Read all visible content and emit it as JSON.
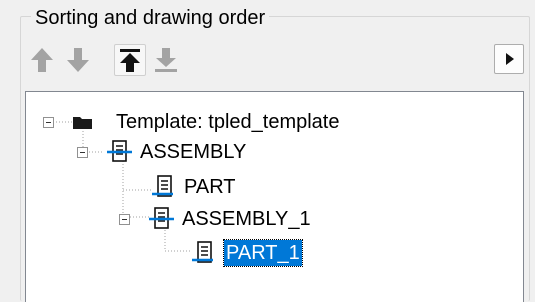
{
  "group": {
    "title": "Sorting and drawing order"
  },
  "toolbar": {
    "buttons": [
      {
        "name": "move-up",
        "icon": "arrow-up-icon",
        "enabled": false
      },
      {
        "name": "move-down",
        "icon": "arrow-down-icon",
        "enabled": false
      },
      {
        "name": "move-to-top",
        "icon": "arrow-to-top-icon",
        "enabled": true
      },
      {
        "name": "move-to-bottom",
        "icon": "arrow-to-bottom-icon",
        "enabled": false
      }
    ],
    "expand_icon": "play-triangle-icon"
  },
  "tree": {
    "nodes": [
      {
        "label": "Template: tpled_template",
        "icon": "folder-icon",
        "level": 0,
        "expanded": true,
        "selected": false
      },
      {
        "label": "ASSEMBLY",
        "icon": "assembly-document-icon",
        "level": 1,
        "expanded": true,
        "selected": false
      },
      {
        "label": "PART",
        "icon": "part-document-icon",
        "level": 2,
        "expanded": false,
        "selected": false
      },
      {
        "label": "ASSEMBLY_1",
        "icon": "assembly-document-icon",
        "level": 2,
        "expanded": true,
        "selected": false
      },
      {
        "label": "PART_1",
        "icon": "part-document-icon",
        "level": 3,
        "expanded": false,
        "selected": true
      }
    ]
  },
  "colors": {
    "selection": "#0078d7",
    "icon_accent": "#0078d7",
    "disabled_icon": "#9a9a9a"
  }
}
